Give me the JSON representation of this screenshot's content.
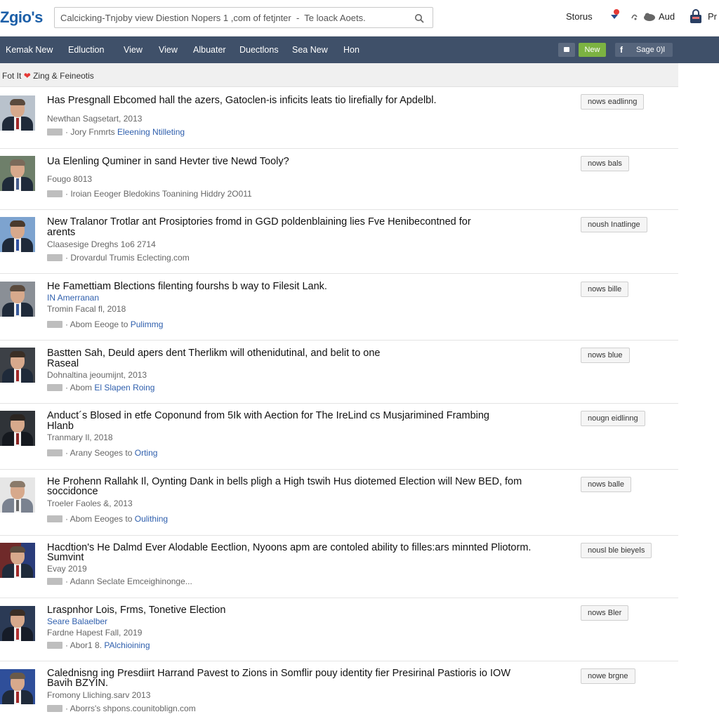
{
  "header": {
    "logo": "Zgio's",
    "search_value": "Calcicking-Tnjoby view Diestion Nopers 1 ,com of fetjnter  -  Te loack Aoets.",
    "stories_label": "Storus",
    "aud_label": "Aud",
    "pr_label": "Pr"
  },
  "nav": {
    "items": [
      "Kemak New",
      "Edluction",
      "View",
      "View",
      "Albuater",
      "Duectlons",
      "Sea New",
      "Hon"
    ],
    "new_button": "New",
    "share_label": "Sage 0)l"
  },
  "subbar": {
    "prefix": "Fot It",
    "suffix": "Zing & Feineotis"
  },
  "articles": [
    {
      "title": "Has Presgnall Ebcomed hall the azers, Gatoclen-is inficits leats tio lirefially for Apdelbl.",
      "meta": "Newthan Sagsetart, 2013",
      "src_prefix": "· Jory Fnmrts ",
      "src_link": "Eleening Ntilleting",
      "tag": "nows eadlinng"
    },
    {
      "title": "Ua Elenling Quminer in sand Hevter tive Newd Tooly?",
      "meta": "Fougo 8013",
      "src_prefix": "· Iroian Eeoger Bledokins Toanining Hiddry 2O011",
      "src_link": "",
      "tag": "nows bals"
    },
    {
      "title": "New Tralanor Trotlar ant Prosiptories fromd in GGD poldenblaining lies Fve Henibecontned for",
      "title2": "arents",
      "meta": "Claasesige Dreghs 1o6 2714",
      "src_prefix": "· Drovardul Trumis Eclecting.com",
      "src_link": "",
      "tag": "noush Inatlinge"
    },
    {
      "title": "He Famettiam Blections filenting fourshs b way to Filesit Lank.",
      "meta_blue": "IN Amerranan",
      "meta": "Tromin Facal fl, 2018",
      "src_prefix": "· Abom Eeoge to ",
      "src_link": "Pulimmg",
      "tag": "nows bille"
    },
    {
      "title": "Bastten Sah, Deuld apers dent Therlikm will othenidutinal, and belit to one",
      "title2": "Raseal",
      "meta": "Dohnaltina jeoumijnt, 2013",
      "src_prefix": "· Abom ",
      "src_link": "El Slapen Roing",
      "tag": "nows blue"
    },
    {
      "title": "Anduct´s Blosed in etfe Coponund from 5Ik with Aection for The IreLind cs Musjarimined Frambing",
      "title2": "Hlanb",
      "meta": "Tranmary Il, 2018",
      "src_prefix": "· Arany Seoges to ",
      "src_link": "Orting",
      "tag": "nougn eidlinng"
    },
    {
      "title": "He Prohenn Rallahk Il, Oynting Dank in bells pligh a High tswih Hus diotemed Election will New BED, fom",
      "title2": "soccidonce",
      "meta": "Troeler Faoles &, 2013",
      "src_prefix": "· Abom Eeoges to ",
      "src_link": "Oulithing",
      "tag": "nows balle"
    },
    {
      "title": "Hacdtion's He Dalmd Ever Alodable Eectlion, Nyoons apm are contoled ability to filles:ars minnted Pliotorm.",
      "title2": "Sumvint",
      "meta": "Evay 2019",
      "src_prefix": "· Adann Seclate Emceighinonge...",
      "src_link": "",
      "tag": "nousl ble bieyels"
    },
    {
      "title": "Lraspnhor Lois, Frms, Tonetive Election",
      "meta_blue": "Seare Balaelber",
      "meta": "Fardne Hapest Fall, 2019",
      "src_prefix": "· Abor1 8. ",
      "src_link": "PAlchioining",
      "tag": "nows Bler"
    },
    {
      "title": "Calednisng ing Presdiirt Harrand Pavest to Zions in Somflir pouy identity fier Presirinal Pastioris io IOW",
      "title2": "Bavih BZYIN.",
      "meta": "Fromony Lliching.sarv 2013",
      "src_prefix": "· Aborrs's shpons.counitoblign.com",
      "src_link": "",
      "tag": "nowe brgne"
    }
  ],
  "colors": {
    "nav_bg": "#3f5069",
    "new_button": "#7cb342",
    "link": "#2f5fad",
    "logo": "#1c5fa8"
  }
}
